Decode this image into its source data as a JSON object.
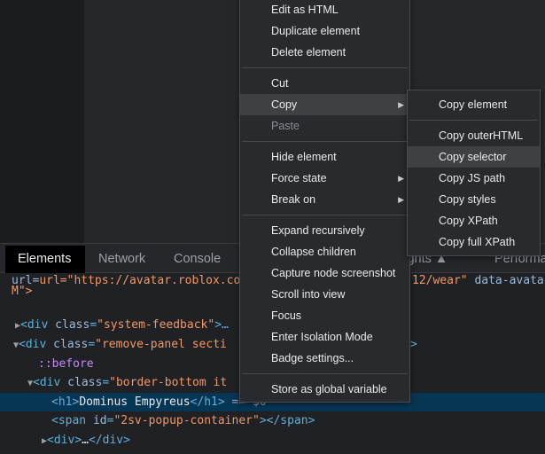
{
  "tabs": [
    {
      "label": "Elements",
      "active": true
    },
    {
      "label": "Network"
    },
    {
      "label": "Console"
    },
    {
      "label": "sights ▲"
    },
    {
      "label": "Performa"
    }
  ],
  "code": {
    "l1_left": "url=\"https://avatar.roblox.com/",
    "l1_right_val": "12/wear\"",
    "l1_right_attr": " data-avata",
    "l2": "M\">",
    "l3_attr": "class",
    "l3_val": "\"system-feedback\"",
    "l3_tail": ">…",
    "l4_attr": "class",
    "l4_val": "\"remove-panel secti",
    "l4_tail": ">",
    "l5": "::before",
    "l6_attr": "class",
    "l6_val": "\"border-bottom it",
    "l7_text": "Dominus Empyreus",
    "l7_after": " == $0",
    "l8_attr": "id",
    "l8_val": "\"2sv-popup-container\"",
    "l9_ellipsis": "…"
  },
  "context_menu": {
    "items": [
      {
        "label": "Edit as HTML"
      },
      {
        "label": "Duplicate element"
      },
      {
        "label": "Delete element"
      },
      {
        "label": "Cut"
      },
      {
        "label": "Copy",
        "submenu": true,
        "hovered": true
      },
      {
        "label": "Paste",
        "disabled": true
      },
      {
        "label": "Hide element"
      },
      {
        "label": "Force state",
        "submenu": true
      },
      {
        "label": "Break on",
        "submenu": true
      },
      {
        "label": "Expand recursively"
      },
      {
        "label": "Collapse children"
      },
      {
        "label": "Capture node screenshot"
      },
      {
        "label": "Scroll into view"
      },
      {
        "label": "Focus"
      },
      {
        "label": "Enter Isolation Mode"
      },
      {
        "label": "Badge settings..."
      },
      {
        "label": "Store as global variable"
      }
    ]
  },
  "copy_submenu": {
    "items": [
      {
        "label": "Copy element"
      },
      {
        "label": "Copy outerHTML"
      },
      {
        "label": "Copy selector",
        "hovered": true
      },
      {
        "label": "Copy JS path"
      },
      {
        "label": "Copy styles"
      },
      {
        "label": "Copy XPath"
      },
      {
        "label": "Copy full XPath"
      }
    ]
  },
  "colors": {
    "selected_row": "#073655",
    "menu_bg": "#292a2d",
    "hover": "#3f4042"
  }
}
